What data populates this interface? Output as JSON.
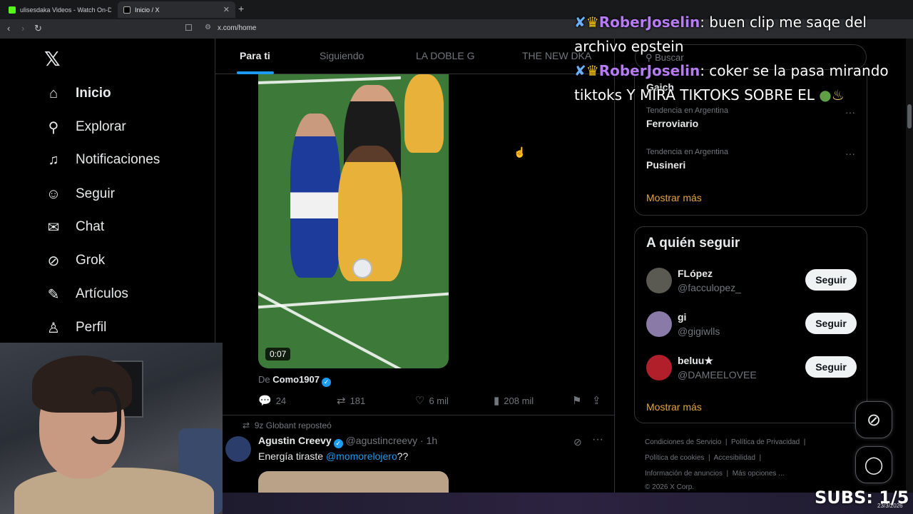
{
  "browser": {
    "tabs": [
      {
        "title": "ulisesdaka Videos - Watch On-Deman",
        "favicon_color": "#53fc18"
      },
      {
        "title": "Inicio / X",
        "favicon_color": "#e7e9ea"
      }
    ],
    "url": "x.com/home"
  },
  "leftnav": {
    "logo": "𝕏",
    "items": [
      {
        "label": "Inicio",
        "icon": "home-icon",
        "glyph": "⌂"
      },
      {
        "label": "Explorar",
        "icon": "search-icon",
        "glyph": "⚲"
      },
      {
        "label": "Notificaciones",
        "icon": "bell-icon",
        "glyph": "🔔"
      },
      {
        "label": "Seguir",
        "icon": "add-user-icon",
        "glyph": "👤"
      },
      {
        "label": "Chat",
        "icon": "mail-icon",
        "glyph": "✉"
      },
      {
        "label": "Grok",
        "icon": "grok-icon",
        "glyph": "⊘"
      },
      {
        "label": "Artículos",
        "icon": "article-icon",
        "glyph": "✎"
      },
      {
        "label": "Perfil",
        "icon": "profile-icon",
        "glyph": "👤"
      }
    ]
  },
  "feed": {
    "tabs": [
      "Para ti",
      "Siguiendo",
      "LA DOBLE G",
      "THE NEW DKA"
    ],
    "post1": {
      "duration": "0:07",
      "from_prefix": "De",
      "from_account": "Como1907",
      "replies": "24",
      "reposts": "181",
      "likes": "6 mil",
      "views": "208 mil"
    },
    "post2": {
      "repost_line": "9z Globant reposteó",
      "name": "Agustin Creevy",
      "handle": "@agustincreevy",
      "time": "· 1h",
      "text": "Energía tiraste ",
      "mention": "@momorelojero",
      "text_end": "??"
    }
  },
  "sidebar": {
    "search_placeholder": "Buscar",
    "trends": [
      {
        "meta": "",
        "name": "Gaich"
      },
      {
        "meta": "Tendencia en Argentina",
        "name": "Ferroviario"
      },
      {
        "meta": "Tendencia en Argentina",
        "name": "Pusineri"
      }
    ],
    "show_more": "Mostrar más",
    "follow_title": "A quién seguir",
    "follow": [
      {
        "name": "FLópez",
        "handle": "@facculopez_",
        "button": "Seguir",
        "avatar_color": "#5a5a52"
      },
      {
        "name": "gi",
        "handle": "@gigiwlls",
        "button": "Seguir",
        "avatar_color": "#8a7aa8"
      },
      {
        "name": "beluu★",
        "handle": "@DAMEELOVEE",
        "button": "Seguir",
        "avatar_color": "#b01f2a"
      }
    ],
    "footer": {
      "line1a": "Condiciones de Servicio",
      "line1b": "Política de Privacidad",
      "line2a": "Política de cookies",
      "line2b": "Accesibilidad",
      "line3a": "Información de anuncios",
      "line3b": "Más opciones ...",
      "copyright": "© 2026 X Corp."
    }
  },
  "overlay": {
    "chat": [
      {
        "user": "RoberJoselin",
        "message": ": buen clip me saqe del archivo epstein"
      },
      {
        "user": "RoberJoselin",
        "message": ": coker se la pasa mirando tiktoks Y MIRA TIKTOKS SOBRE EL"
      }
    ],
    "subs": "SUBS: 1/5",
    "date": "23/3/2026"
  },
  "colors": {
    "accent": "#1d9bf0",
    "show_more": "#e7a43f",
    "chat_user": "#b57cf5"
  }
}
